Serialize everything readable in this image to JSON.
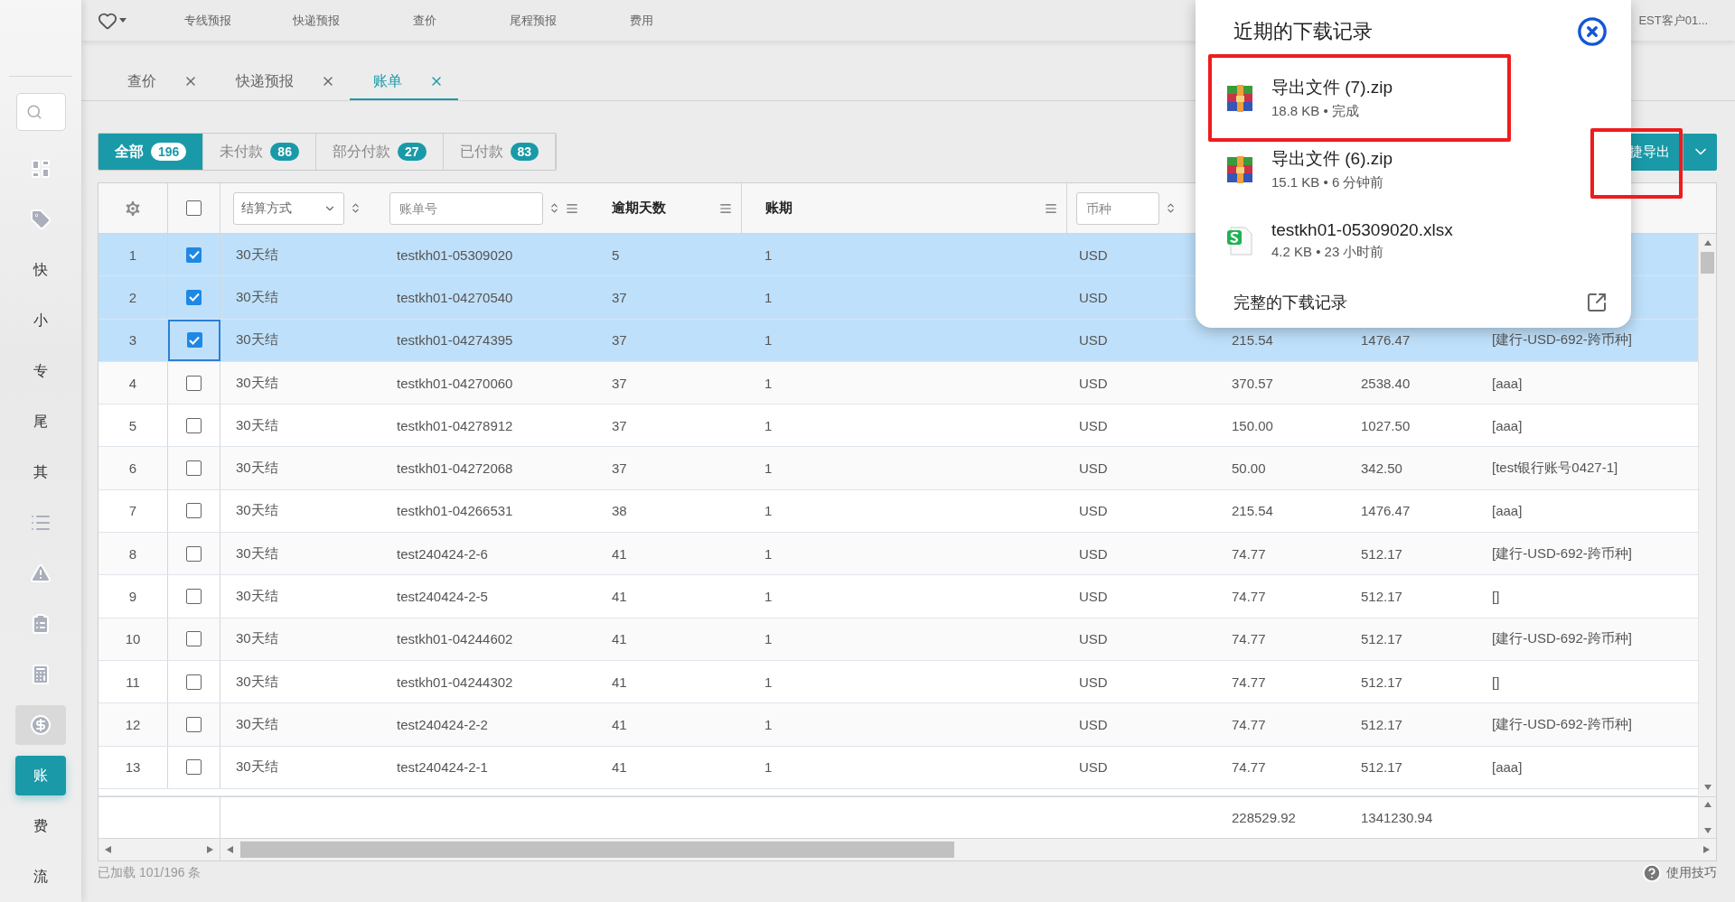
{
  "top_nav": {
    "items": [
      "专线预报",
      "快递预报",
      "查价",
      "尾程预报",
      "费用"
    ],
    "user": "EST客户01..."
  },
  "sidebar": {
    "items": [
      {
        "kind": "icon",
        "selected": false,
        "hovered": false
      },
      {
        "kind": "icon",
        "selected": false,
        "hovered": false
      },
      {
        "kind": "text",
        "label": "快",
        "selected": false,
        "hovered": false
      },
      {
        "kind": "text",
        "label": "小",
        "selected": false,
        "hovered": false
      },
      {
        "kind": "text",
        "label": "专",
        "selected": false,
        "hovered": false
      },
      {
        "kind": "text",
        "label": "尾",
        "selected": false,
        "hovered": false
      },
      {
        "kind": "text",
        "label": "其",
        "selected": false,
        "hovered": false
      },
      {
        "kind": "icon",
        "selected": false,
        "hovered": false
      },
      {
        "kind": "icon",
        "selected": false,
        "hovered": false
      },
      {
        "kind": "icon",
        "selected": false,
        "hovered": false
      },
      {
        "kind": "icon",
        "selected": false,
        "hovered": false
      },
      {
        "kind": "icon",
        "selected": false,
        "hovered": true
      },
      {
        "kind": "text",
        "label": "账",
        "selected": true,
        "hovered": false
      },
      {
        "kind": "text",
        "label": "费",
        "selected": false,
        "hovered": false
      },
      {
        "kind": "text",
        "label": "流",
        "selected": false,
        "hovered": false
      }
    ]
  },
  "tabs": [
    {
      "label": "查价",
      "selected": false
    },
    {
      "label": "快递预报",
      "selected": false
    },
    {
      "label": "账单",
      "selected": true
    }
  ],
  "filters": [
    {
      "label": "全部",
      "count": "196",
      "selected": true
    },
    {
      "label": "未付款",
      "count": "86",
      "selected": false
    },
    {
      "label": "部分付款",
      "count": "27",
      "selected": false
    },
    {
      "label": "已付款",
      "count": "83",
      "selected": false
    }
  ],
  "export_button": {
    "label": "捷导出",
    "highlight": true
  },
  "table": {
    "select_all_checked": false,
    "settlement_placeholder": "结算方式",
    "bill_placeholder": "账单号",
    "overdue_header": "逾期天数",
    "period_header": "账期",
    "currency_placeholder": "币种",
    "rows": [
      {
        "number": "1",
        "selected": true,
        "checked": true,
        "focused": false,
        "settlement": "30天结",
        "bill_no": "testkh01-05309020",
        "overdue_days": "5",
        "period": "1",
        "currency": "USD"
      },
      {
        "number": "2",
        "selected": true,
        "checked": true,
        "focused": false,
        "settlement": "30天结",
        "bill_no": "testkh01-04270540",
        "overdue_days": "37",
        "period": "1",
        "currency": "USD"
      },
      {
        "number": "3",
        "selected": true,
        "checked": true,
        "focused": true,
        "settlement": "30天结",
        "bill_no": "testkh01-04274395",
        "overdue_days": "37",
        "period": "1",
        "currency": "USD",
        "column_8": "215.54",
        "column_9": "1476.47",
        "column_10": "[建行-USD-692-跨币种]"
      },
      {
        "number": "4",
        "selected": false,
        "checked": false,
        "focused": false,
        "settlement": "30天结",
        "bill_no": "testkh01-04270060",
        "overdue_days": "37",
        "period": "1",
        "currency": "USD",
        "column_8": "370.57",
        "column_9": "2538.40",
        "column_10": "[aaa]"
      },
      {
        "number": "5",
        "selected": false,
        "checked": false,
        "focused": false,
        "settlement": "30天结",
        "bill_no": "testkh01-04278912",
        "overdue_days": "37",
        "period": "1",
        "currency": "USD",
        "column_8": "150.00",
        "column_9": "1027.50",
        "column_10": "[aaa]"
      },
      {
        "number": "6",
        "selected": false,
        "checked": false,
        "focused": false,
        "settlement": "30天结",
        "bill_no": "testkh01-04272068",
        "overdue_days": "37",
        "period": "1",
        "currency": "USD",
        "column_8": "50.00",
        "column_9": "342.50",
        "column_10": "[test银行账号0427-1]"
      },
      {
        "number": "7",
        "selected": false,
        "checked": false,
        "focused": false,
        "settlement": "30天结",
        "bill_no": "testkh01-04266531",
        "overdue_days": "38",
        "period": "1",
        "currency": "USD",
        "column_8": "215.54",
        "column_9": "1476.47",
        "column_10": "[aaa]"
      },
      {
        "number": "8",
        "selected": false,
        "checked": false,
        "focused": false,
        "settlement": "30天结",
        "bill_no": "test240424-2-6",
        "overdue_days": "41",
        "period": "1",
        "currency": "USD",
        "column_8": "74.77",
        "column_9": "512.17",
        "column_10": "[建行-USD-692-跨币种]"
      },
      {
        "number": "9",
        "selected": false,
        "checked": false,
        "focused": false,
        "settlement": "30天结",
        "bill_no": "test240424-2-5",
        "overdue_days": "41",
        "period": "1",
        "currency": "USD",
        "column_8": "74.77",
        "column_9": "512.17",
        "column_10": "[]"
      },
      {
        "number": "10",
        "selected": false,
        "checked": false,
        "focused": false,
        "settlement": "30天结",
        "bill_no": "testkh01-04244602",
        "overdue_days": "41",
        "period": "1",
        "currency": "USD",
        "column_8": "74.77",
        "column_9": "512.17",
        "column_10": "[建行-USD-692-跨币种]"
      },
      {
        "number": "11",
        "selected": false,
        "checked": false,
        "focused": false,
        "settlement": "30天结",
        "bill_no": "testkh01-04244302",
        "overdue_days": "41",
        "period": "1",
        "currency": "USD",
        "column_8": "74.77",
        "column_9": "512.17",
        "column_10": "[]"
      },
      {
        "number": "12",
        "selected": false,
        "checked": false,
        "focused": false,
        "settlement": "30天结",
        "bill_no": "test240424-2-2",
        "overdue_days": "41",
        "period": "1",
        "currency": "USD",
        "column_8": "74.77",
        "column_9": "512.17",
        "column_10": "[建行-USD-692-跨币种]"
      },
      {
        "number": "13",
        "selected": false,
        "checked": false,
        "focused": false,
        "settlement": "30天结",
        "bill_no": "test240424-2-1",
        "overdue_days": "41",
        "period": "1",
        "currency": "USD",
        "column_8": "74.77",
        "column_9": "512.17",
        "column_10": "[aaa]"
      }
    ],
    "summary": {
      "column_8": "228529.92",
      "column_9": "1341230.94"
    }
  },
  "status_bar": {
    "loaded": "已加载 101/196 条",
    "help": "使用技巧"
  },
  "download_popup": {
    "title": "近期的下载记录",
    "items": [
      {
        "kind": "zip",
        "name": "导出文件 (7).zip",
        "detail": "18.8 KB • 完成",
        "highlight": true
      },
      {
        "kind": "zip",
        "name": "导出文件 (6).zip",
        "detail": "15.1 KB • 6 分钟前",
        "highlight": false
      },
      {
        "kind": "sheet",
        "name": "testkh01-05309020.xlsx",
        "detail": "4.2 KB • 23 小时前",
        "highlight": false
      }
    ],
    "footer": "完整的下载记录"
  }
}
